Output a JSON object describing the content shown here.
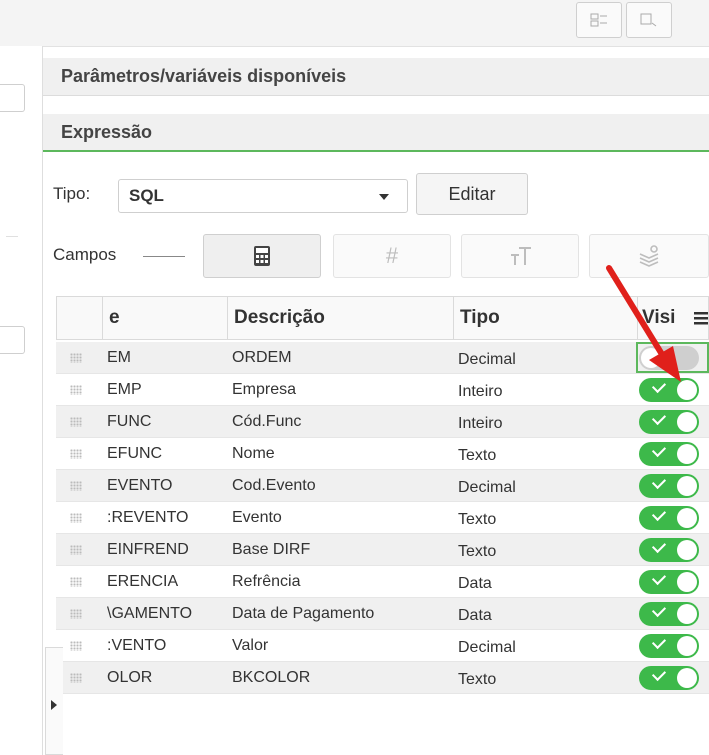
{
  "toolbar": {
    "icons": [
      "grid-search-icon",
      "zoom-icon"
    ]
  },
  "panel": {
    "section1_title": "Parâmetros/variáveis disponíveis",
    "section2_title": "Expressão",
    "tipo_label": "Tipo:",
    "tipo_value": "SQL",
    "edit_label": "Editar",
    "campos_label": "Campos",
    "tools": [
      "calculator-icon",
      "hash-icon",
      "text-size-icon",
      "layers-icon"
    ]
  },
  "grid": {
    "columns": [
      "e",
      "Descrição",
      "Tipo",
      "Visi"
    ],
    "rows": [
      {
        "name": "EM",
        "desc": "ORDEM",
        "type": "Decimal",
        "visible": false
      },
      {
        "name": "EMP",
        "desc": "Empresa",
        "type": "Inteiro",
        "visible": true
      },
      {
        "name": "FUNC",
        "desc": "Cód.Func",
        "type": "Inteiro",
        "visible": true
      },
      {
        "name": "EFUNC",
        "desc": "Nome",
        "type": "Texto",
        "visible": true
      },
      {
        "name": "EVENTO",
        "desc": "Cod.Evento",
        "type": "Decimal",
        "visible": true
      },
      {
        "name": ":REVENTO",
        "desc": "Evento",
        "type": "Texto",
        "visible": true
      },
      {
        "name": "EINFREND",
        "desc": "Base DIRF",
        "type": "Texto",
        "visible": true
      },
      {
        "name": "ERENCIA",
        "desc": "Refrência",
        "type": "Data",
        "visible": true
      },
      {
        "name": "\\GAMENTO",
        "desc": "Data de Pagamento",
        "type": "Data",
        "visible": true
      },
      {
        "name": ":VENTO",
        "desc": "Valor",
        "type": "Decimal",
        "visible": true
      },
      {
        "name": "OLOR",
        "desc": "BKCOLOR",
        "type": "Texto",
        "visible": true
      }
    ]
  },
  "colors": {
    "toggle_on": "#3db94a",
    "toggle_off": "#cfcfcf",
    "accent_green": "#5cb85c",
    "annotation_arrow": "#e0201b"
  }
}
